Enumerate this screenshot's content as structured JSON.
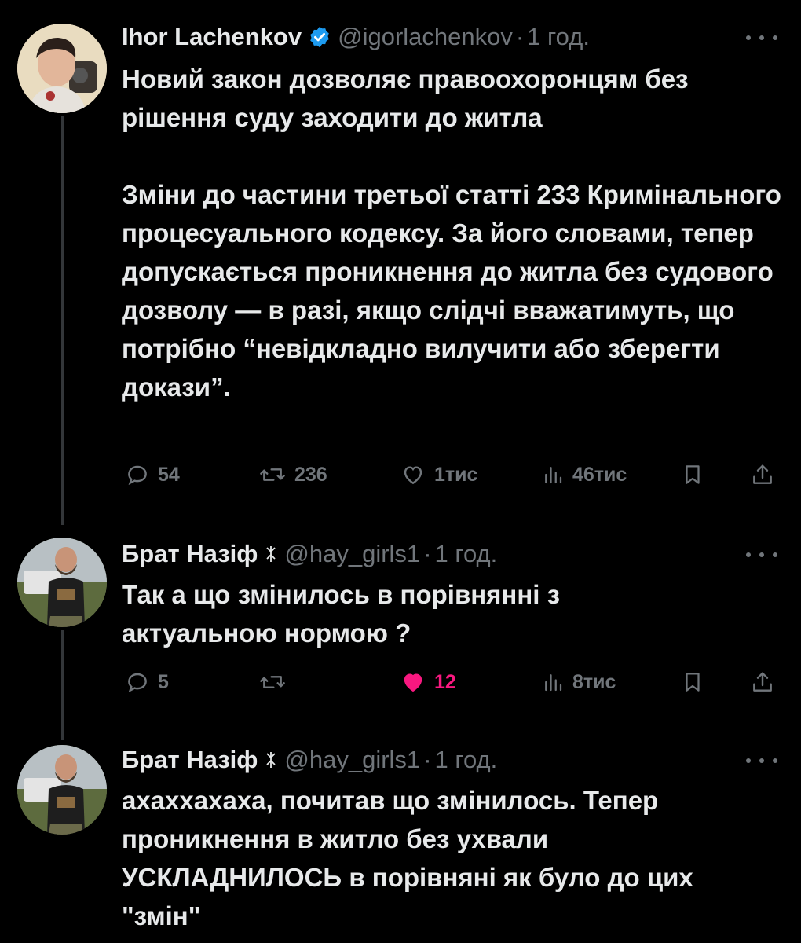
{
  "tweets": [
    {
      "name": "Ihor Lachenkov",
      "handle": "@igorlachenkov",
      "separator": "·",
      "time": "1 год.",
      "verified": true,
      "paragraphs": [
        "Новий закон дозволяє правоохоронцям без рішення суду заходити до житла",
        "Зміни до частини третьої статті 233 Кримінального процесуального кодексу. За його словами, тепер допускається проникнення до житла без судового дозволу — в разі, якщо слідчі вважатимуть, що потрібно “невідкладно вилучити або зберегти докази”."
      ],
      "replies": "54",
      "reposts": "236",
      "likes": "1тис",
      "views": "46тис",
      "liked": false
    },
    {
      "name": "Брат Назіф",
      "handle": "@hay_girls1",
      "separator": "·",
      "time": "1 год.",
      "flag_icon": "rune-icon",
      "paragraphs": [
        "Так а що змінилось в порівнянні з актуальною нормою ?"
      ],
      "replies": "5",
      "reposts": "",
      "likes": "12",
      "views": "8тис",
      "liked": true
    },
    {
      "name": "Брат Назіф",
      "handle": "@hay_girls1",
      "separator": "·",
      "time": "1 год.",
      "flag_icon": "rune-icon",
      "paragraphs": [
        "ахаххахаха, почитав що змінилось. Тепер проникнення в житло без ухвали УСКЛАДНИЛОСЬ в порівняні як було до цих \"змін\""
      ]
    }
  ],
  "colors": {
    "background": "#000000",
    "text": "#e7e9ea",
    "muted": "#71767b",
    "like": "#f91880",
    "verified": "#1d9bf0"
  }
}
